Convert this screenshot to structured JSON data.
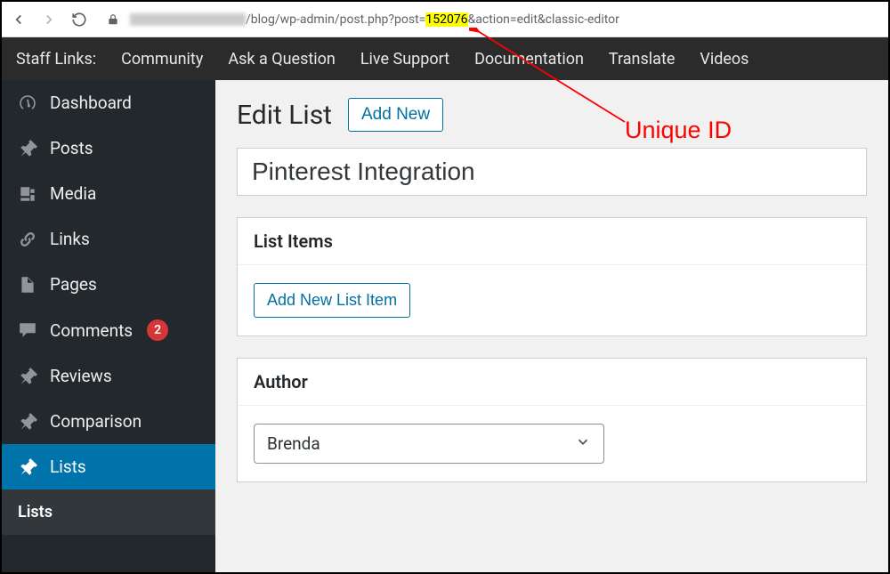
{
  "browser": {
    "url_prefix": "/blog/wp-admin/post.php?post=",
    "url_id": "152076",
    "url_suffix": "&action=edit&classic-editor"
  },
  "staff_bar": {
    "label": "Staff Links:",
    "links": [
      "Community",
      "Ask a Question",
      "Live Support",
      "Documentation",
      "Translate",
      "Videos"
    ]
  },
  "sidebar": {
    "items": [
      {
        "label": "Dashboard",
        "icon": "dashboard"
      },
      {
        "label": "Posts",
        "icon": "pin"
      },
      {
        "label": "Media",
        "icon": "media"
      },
      {
        "label": "Links",
        "icon": "link"
      },
      {
        "label": "Pages",
        "icon": "page"
      },
      {
        "label": "Comments",
        "icon": "comment",
        "badge": "2"
      },
      {
        "label": "Reviews",
        "icon": "pin"
      },
      {
        "label": "Comparison",
        "icon": "pin"
      },
      {
        "label": "Lists",
        "icon": "pin",
        "active": true
      }
    ],
    "submenu": {
      "label": "Lists"
    }
  },
  "content": {
    "page_title": "Edit List",
    "add_new": "Add New",
    "post_title_value": "Pinterest Integration",
    "panels": {
      "list_items": {
        "title": "List Items",
        "button": "Add New List Item"
      },
      "author": {
        "title": "Author",
        "selected": "Brenda"
      }
    }
  },
  "annotation": {
    "text": "Unique ID"
  }
}
